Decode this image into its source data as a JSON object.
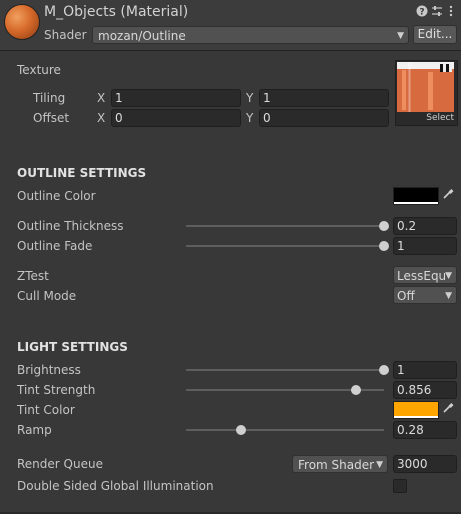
{
  "header": {
    "title": "M_Objects (Material)",
    "shader_label": "Shader",
    "shader_value": "mozan/Outline",
    "edit_button": "Edit...",
    "icons": [
      "help-icon",
      "presets-icon",
      "menu-icon"
    ]
  },
  "texture": {
    "label": "Texture",
    "tiling_label": "Tiling",
    "offset_label": "Offset",
    "x_label": "X",
    "y_label": "Y",
    "tiling_x": "1",
    "tiling_y": "1",
    "offset_x": "0",
    "offset_y": "0",
    "select_label": "Select"
  },
  "outline": {
    "section_title": "OUTLINE SETTINGS",
    "color_label": "Outline Color",
    "color_value": "#000000",
    "thickness_label": "Outline Thickness",
    "thickness_value": "0.2",
    "thickness_fraction": 1.0,
    "fade_label": "Outline Fade",
    "fade_value": "1",
    "fade_fraction": 1.0,
    "ztest_label": "ZTest",
    "ztest_value": "LessEqu",
    "cull_label": "Cull Mode",
    "cull_value": "Off"
  },
  "light": {
    "section_title": "LIGHT SETTINGS",
    "brightness_label": "Brightness",
    "brightness_value": "1",
    "brightness_fraction": 1.0,
    "tint_strength_label": "Tint Strength",
    "tint_strength_value": "0.856",
    "tint_strength_fraction": 0.86,
    "tint_color_label": "Tint Color",
    "tint_color_value": "#ffa500",
    "ramp_label": "Ramp",
    "ramp_value": "0.28",
    "ramp_fraction": 0.28
  },
  "render": {
    "queue_label": "Render Queue",
    "queue_mode": "From Shader",
    "queue_value": "3000",
    "dsgi_label": "Double Sided Global Illumination",
    "dsgi_checked": false
  }
}
